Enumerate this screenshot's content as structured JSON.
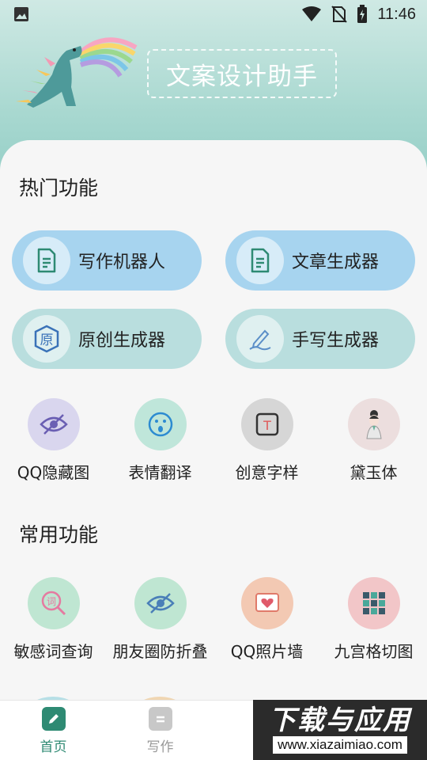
{
  "status_bar": {
    "time": "11:46",
    "icons": [
      "image-icon",
      "wifi-icon",
      "no-sim-icon",
      "battery-charging-icon"
    ]
  },
  "header": {
    "title": "文案设计助手"
  },
  "hot": {
    "title": "热门功能",
    "pills": [
      {
        "label": "写作机器人",
        "icon": "document-icon"
      },
      {
        "label": "文章生成器",
        "icon": "document-icon"
      },
      {
        "label": "原创生成器",
        "icon": "original-badge-icon"
      },
      {
        "label": "手写生成器",
        "icon": "pen-icon"
      }
    ],
    "pill_badge_char": "原",
    "grid": [
      {
        "label": "QQ隐藏图",
        "icon": "eye-hidden-icon"
      },
      {
        "label": "表情翻译",
        "icon": "emoji-icon"
      },
      {
        "label": "创意字样",
        "icon": "text-box-icon"
      },
      {
        "label": "黛玉体",
        "icon": "portrait-icon"
      }
    ],
    "text_box_char": "T"
  },
  "common": {
    "title": "常用功能",
    "grid": [
      {
        "label": "敏感词查询",
        "icon": "word-search-icon"
      },
      {
        "label": "朋友圈防折叠",
        "icon": "eye-hidden-icon"
      },
      {
        "label": "QQ照片墙",
        "icon": "photo-heart-icon"
      },
      {
        "label": "九宫格切图",
        "icon": "grid-nine-icon"
      }
    ],
    "word_search_char": "词"
  },
  "tabs": [
    {
      "label": "首页",
      "active": true,
      "icon": "edit-icon"
    },
    {
      "label": "写作",
      "active": false,
      "icon": "notes-icon"
    }
  ],
  "watermark": {
    "title": "下载与应用",
    "url": "www.xiazaimiao.com"
  },
  "colors": {
    "accent": "#2e8a73",
    "pill_blue": "#a7d4ef",
    "pill_teal": "#b9dede"
  }
}
